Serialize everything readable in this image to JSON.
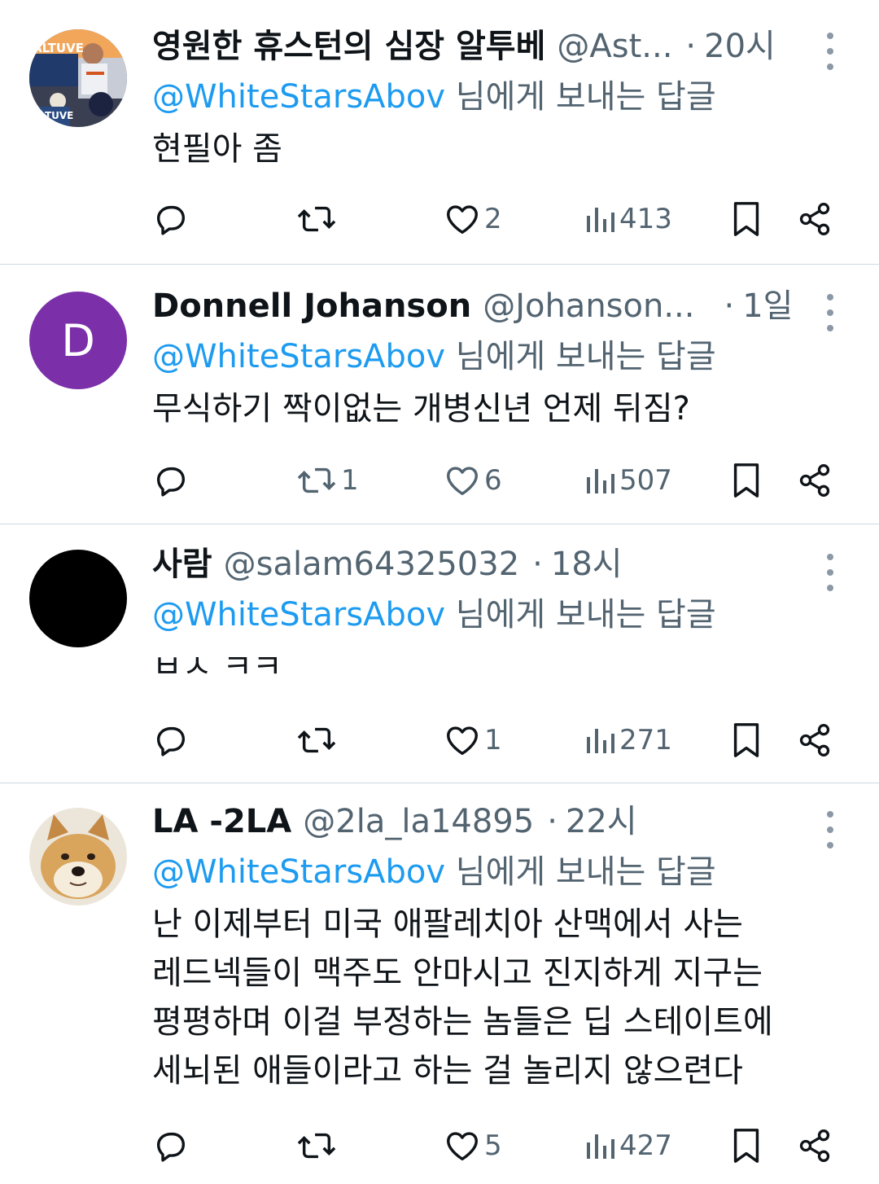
{
  "replying_suffix": " 님에게 보내는 답글",
  "tweets": [
    {
      "name": "영원한 휴스턴의 심장 알투베",
      "handle": "@Ast...",
      "dot": "·",
      "time": "20시",
      "mention": "@WhiteStarsAbov",
      "text": "현필아 좀",
      "avatar_label": "ALTUVE",
      "likes": "2",
      "views": "413",
      "retweets": ""
    },
    {
      "name": "Donnell Johanson",
      "handle": "@Johanson...",
      "dot": "·",
      "time": "1일",
      "mention": "@WhiteStarsAbov",
      "text": "무식하기 짝이없는 개병신년 언제 뒤짐?",
      "avatar_letter": "D",
      "avatar_color": "#7b2fa8",
      "likes": "6",
      "views": "507",
      "retweets": "1"
    },
    {
      "name": "사람",
      "handle": "@salam64325032",
      "dot": "·",
      "time": "18시",
      "mention": "@WhiteStarsAbov",
      "text": "ㅂㅅ ㅋㅋ",
      "likes": "1",
      "views": "271",
      "retweets": ""
    },
    {
      "name": "LA -2LA",
      "handle": "@2la_la14895",
      "dot": "·",
      "time": "22시",
      "mention": "@WhiteStarsAbov",
      "text": "난 이제부터 미국 애팔레치아 산맥에서 사는\n레드넥들이 맥주도 안마시고 진지하게 지구는\n평평하며 이걸 부정하는 놈들은 딥 스테이트에\n세뇌된 애들이라고 하는 걸 놀리지 않으련다",
      "likes": "5",
      "views": "427",
      "retweets": ""
    }
  ],
  "colors": {
    "text": "#0f1419",
    "secondary": "#536471",
    "mention": "#1d9bf0",
    "divider": "#cfd9de"
  },
  "icons": [
    "reply-icon",
    "retweet-icon",
    "like-icon",
    "views-icon",
    "bookmark-icon",
    "share-icon",
    "more-icon"
  ]
}
